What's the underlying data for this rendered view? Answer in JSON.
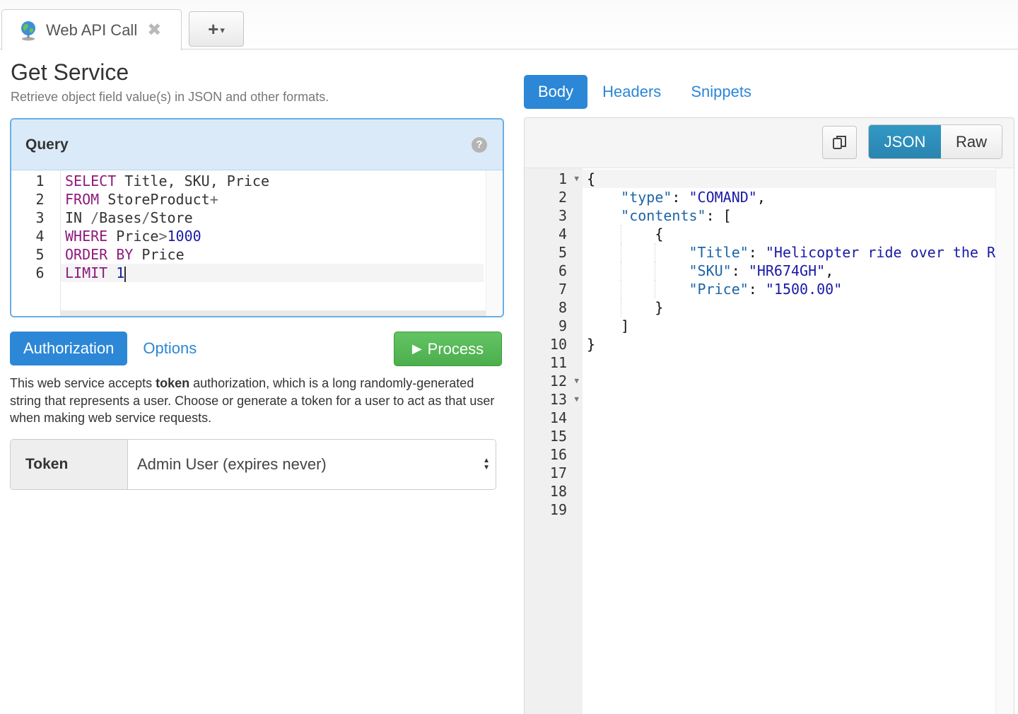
{
  "tabbar": {
    "tab_label": "Web API Call",
    "close_glyph": "✖",
    "add_glyph": "+",
    "add_caret": "▾"
  },
  "page": {
    "title": "Get Service",
    "subtitle": "Retrieve object field value(s) in JSON and other formats."
  },
  "query": {
    "title": "Query",
    "help_glyph": "?",
    "line_numbers": [
      "1",
      "2",
      "3",
      "4",
      "5",
      "6"
    ]
  },
  "left_tabs": {
    "authorization": "Authorization",
    "options": "Options"
  },
  "process_label": "Process",
  "auth_text": {
    "before": "This web service accepts ",
    "bold": "token",
    "after": " authorization, which is a long randomly-generated string that represents a user. Choose or generate a token for a user to act as that user when making web service requests."
  },
  "token": {
    "label": "Token",
    "selected": "Admin User (expires never)"
  },
  "right_tabs": {
    "body": "Body",
    "headers": "Headers",
    "snippets": "Snippets"
  },
  "format": {
    "json": "JSON",
    "raw": "Raw"
  },
  "result": {
    "line_numbers": [
      "1",
      "2",
      "3",
      "4",
      "5",
      "6",
      "7",
      "8",
      "9",
      "10",
      "11",
      "12",
      "13",
      "14",
      "15",
      "16",
      "17",
      "18",
      "19"
    ]
  },
  "colors": {
    "primary": "#2c87d6",
    "success": "#5cb85c",
    "info": "#2a84b0",
    "query_header": "#dbeaf8"
  },
  "icons": {
    "tab": "globe-icon",
    "close": "close-icon",
    "help": "help-icon",
    "play": "play-icon",
    "copy": "copy-icon",
    "select": "select-arrows-icon"
  }
}
